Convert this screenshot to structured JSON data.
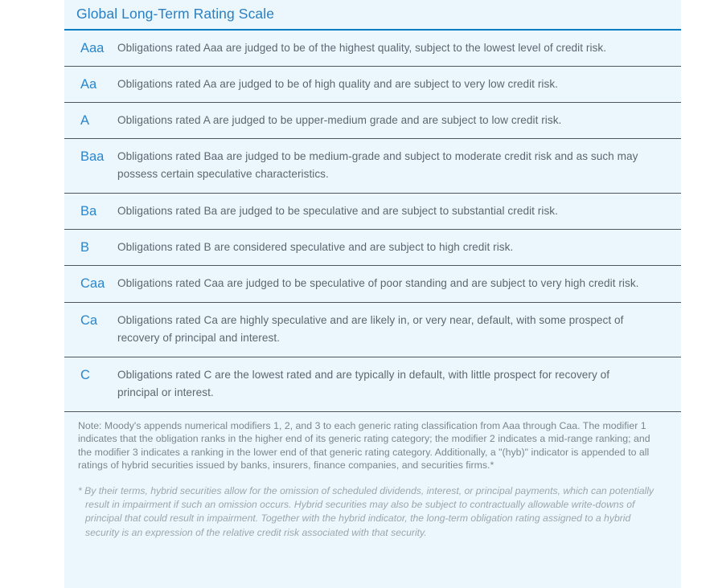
{
  "table": {
    "title": "Global Long-Term Rating Scale",
    "accent_color": "#0a7ec0",
    "background_color": "#ecf7fd",
    "code_color": "#2a86cc",
    "body_text_color": "#5c6670",
    "divider_color": "#50545c",
    "rows": [
      {
        "code": "Aaa",
        "description": "Obligations rated Aaa are judged to be of the highest quality, subject to the lowest level of credit risk."
      },
      {
        "code": "Aa",
        "description": "Obligations rated Aa are judged to be of high quality and are subject to very low credit risk."
      },
      {
        "code": "A",
        "description": "Obligations rated A are judged to be upper-medium grade and are subject to low credit risk."
      },
      {
        "code": "Baa",
        "description": "Obligations rated Baa are judged to be medium-grade and subject to moderate credit risk and as such may possess certain speculative characteristics."
      },
      {
        "code": "Ba",
        "description": "Obligations rated Ba are judged to be speculative and are subject to substantial credit risk."
      },
      {
        "code": "B",
        "description": "Obligations rated B are considered speculative and are subject to high credit risk."
      },
      {
        "code": "Caa",
        "description": "Obligations rated Caa are judged to be speculative of poor standing and are subject to very high credit risk."
      },
      {
        "code": "Ca",
        "description": "Obligations rated Ca are highly speculative and are likely in, or very near, default, with some prospect of recovery of principal and interest."
      },
      {
        "code": "C",
        "description": "Obligations rated C are the lowest rated and are typically in default, with little prospect for recovery of principal or interest."
      }
    ],
    "note": "Note: Moody's appends numerical modifiers 1, 2, and 3 to each generic rating classification from Aaa through Caa. The modifier 1 indicates that the obligation ranks in the higher end of its generic rating category; the modifier 2 indicates a mid-range ranking; and the modifier 3 indicates a ranking in the lower end of that generic rating category. Additionally, a \"(hyb)\" indicator is appended to all ratings of hybrid securities issued by banks, insurers, finance companies, and securities firms.*",
    "footnote": "* By their terms, hybrid securities allow for the omission of scheduled dividends, interest, or principal payments, which can potentially result in impairment if such an omission occurs.  Hybrid securities may also be subject to contractually allowable write-downs of principal that could result in impairment. Together with the hybrid indicator, the long-term obligation rating assigned to a hybrid security is an expression of the relative credit risk associated with that security."
  }
}
